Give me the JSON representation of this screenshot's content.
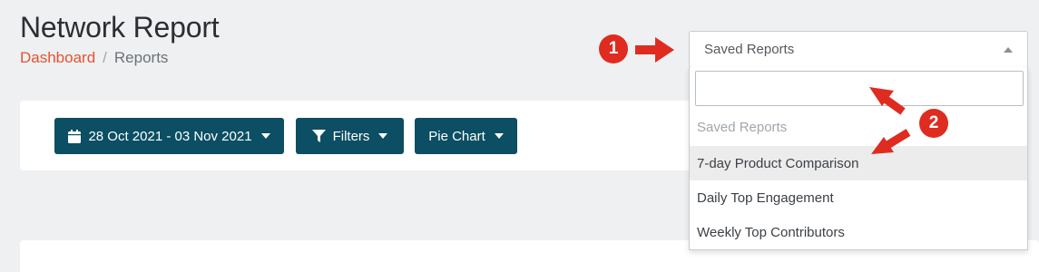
{
  "page": {
    "title": "Network Report"
  },
  "breadcrumb": {
    "items": [
      {
        "label": "Dashboard"
      },
      {
        "label": "/"
      },
      {
        "label": "Reports"
      }
    ]
  },
  "toolbar": {
    "date_range_label": "28 Oct 2021 - 03 Nov 2021",
    "filters_label": "Filters",
    "chart_type_label": "Pie Chart"
  },
  "saved_reports": {
    "selected_label": "Saved Reports",
    "search_value": "",
    "group_label": "Saved Reports",
    "options": [
      {
        "label": "7-day Product Comparison"
      },
      {
        "label": "Daily Top Engagement"
      },
      {
        "label": "Weekly Top Contributors"
      }
    ]
  },
  "callouts": {
    "step_1": "1",
    "step_2": "2"
  },
  "icons": {
    "calendar": "calendar-icon",
    "filter": "filter-icon",
    "caret": "caret-down-icon"
  },
  "colors": {
    "accent_link": "#e5532f",
    "button_bg": "#0c4e63",
    "callout_red": "#e02b20",
    "page_bg": "#eef0f2"
  }
}
